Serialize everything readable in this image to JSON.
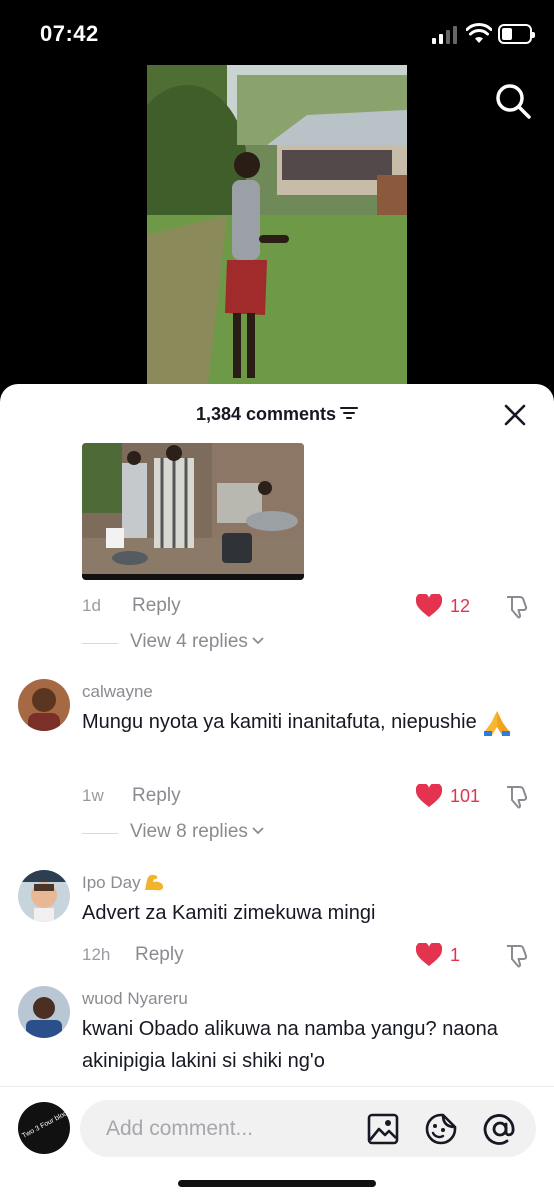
{
  "status_bar": {
    "time": "07:42",
    "battery_level": 0.3,
    "signal_bars": 2
  },
  "video": {
    "search_icon": "search-icon"
  },
  "sheet": {
    "comments_count": "1,384 comments",
    "filter_icon": "filter-icon",
    "close_icon": "close-icon"
  },
  "comments": [
    {
      "time": "1d",
      "reply_label": "Reply",
      "likes": "12",
      "view_replies": "View 4 replies"
    },
    {
      "username": "calwayne",
      "text": "Mungu nyota ya kamiti inanitafuta, niepushie",
      "emoji": "folded-hands-emoji",
      "time": "1w",
      "reply_label": "Reply",
      "likes": "101",
      "view_replies": "View 8 replies"
    },
    {
      "username": "Ipo Day",
      "emoji": "flexed-biceps-emoji",
      "text": "Advert za Kamiti zimekuwa mingi",
      "time": "12h",
      "reply_label": "Reply",
      "likes": "1"
    },
    {
      "username": "wuod Nyareru",
      "text": "kwani Obado alikuwa na namba yangu? naona akinipigia lakini si shiki ng'o"
    }
  ],
  "bottom_bar": {
    "avatar_text": "Two 3 Four block",
    "placeholder": "Add comment...",
    "icons": [
      "image-icon",
      "sticker-icon",
      "mention-icon"
    ]
  },
  "colors": {
    "like": "#fe2c55",
    "text": "#161823",
    "muted": "#8a8b91"
  }
}
